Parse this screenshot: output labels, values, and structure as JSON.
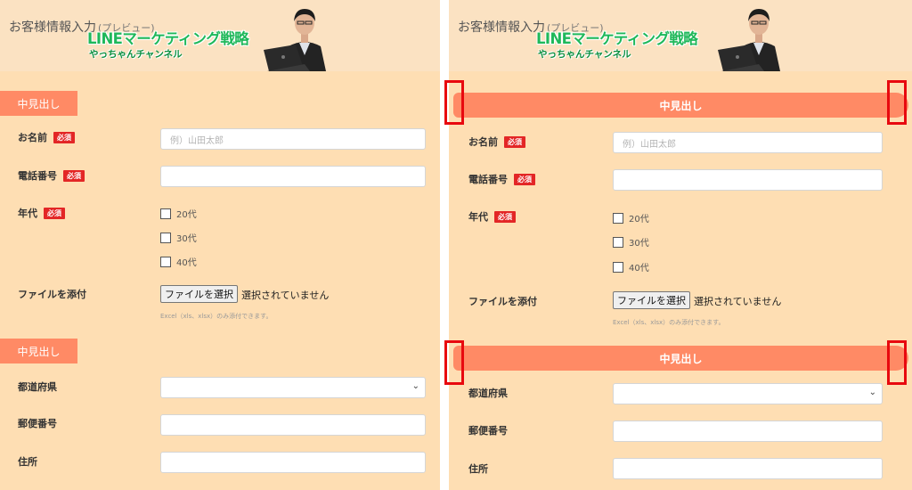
{
  "banner": {
    "title": "お客様情報入力",
    "title_suffix": "(プレビュー)",
    "logo_main": "LINEマーケティング戦略",
    "logo_sub": "やっちゃんチャンネル"
  },
  "form": {
    "section_heading": "中見出し",
    "required_badge": "必須",
    "name_label": "お名前",
    "name_placeholder": "例）山田太郎",
    "phone_label": "電話番号",
    "age_label": "年代",
    "age_options": [
      "20代",
      "30代",
      "40代"
    ],
    "file_label": "ファイルを添付",
    "file_button": "ファイルを選択",
    "file_status": "選択されていません",
    "file_note": "Excel（xls、xlsx）のみ添付できます。",
    "prefecture_label": "都道府県",
    "postal_label": "郵便番号",
    "address_label": "住所"
  },
  "icons": {
    "select_chevron": "chevron-down-icon"
  },
  "colors": {
    "panel_background": "#fedeb3",
    "heading_background": "#ff8a65",
    "required_badge": "#e32626",
    "highlight_marker": "#e8090f",
    "logo_green": "#1fb85a"
  }
}
